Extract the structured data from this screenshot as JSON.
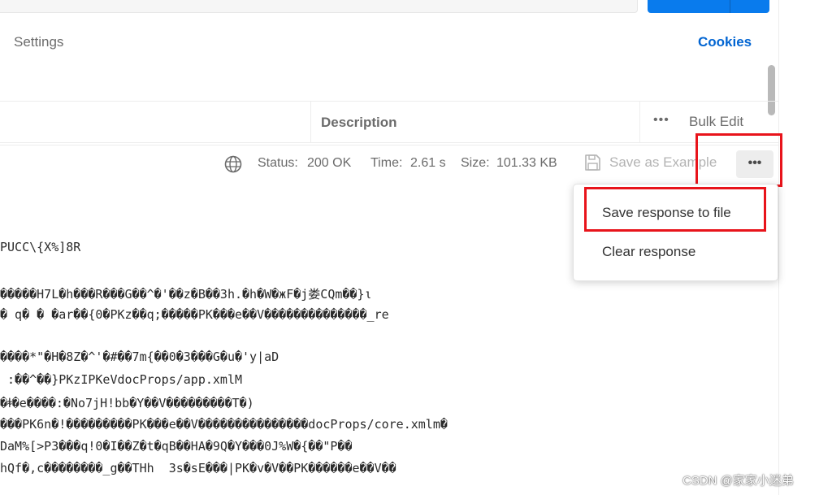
{
  "tabs": {
    "settings": "Settings",
    "cookies": "Cookies"
  },
  "table_header": {
    "description": "Description",
    "more": "•••",
    "bulk_edit": "Bulk Edit"
  },
  "response": {
    "status_label": "Status:",
    "status_value": "200 OK",
    "time_label": "Time:",
    "time_value": "2.61 s",
    "size_label": "Size:",
    "size_value": "101.33 KB",
    "save_as_example": "Save as Example",
    "more": "•••"
  },
  "menu": {
    "save_to_file": "Save response to file",
    "clear": "Clear response"
  },
  "body_lines": [
    "PUCC\\{X%]8R",
    "�����H7L�h���R���G��^�'��z�B��3h.�h�W�жF�j娄CQm��}ι",
    "� q� � �ar��{0�PKz��q;�����PK���e��V��������������_re",
    "����*\"�H�8Z�^'�#��7m{��0�3���G�u�'y|aD",
    " :��^��}PKzIPKeVdocProps/app.xmlM",
    "�ꬸ�e����:�No7jH!bb�Y��V���������T�)",
    "���PK6n�!���������PK���e��V���������������docProps/core.xmlm�",
    "DaM%[>P3���q!0�I��Z�t�qB��HA�9Q�Y���0J%W�{��\"P��",
    "hQf�,c��������_g��THh  3s�sE���|PK�v�V��PK������e��V��"
  ],
  "watermark": "CSDN @家家小迷弟",
  "colors": {
    "success": "#007f31",
    "accent": "#0265d2",
    "highlight": "#e8141b",
    "send": "#097bed"
  }
}
